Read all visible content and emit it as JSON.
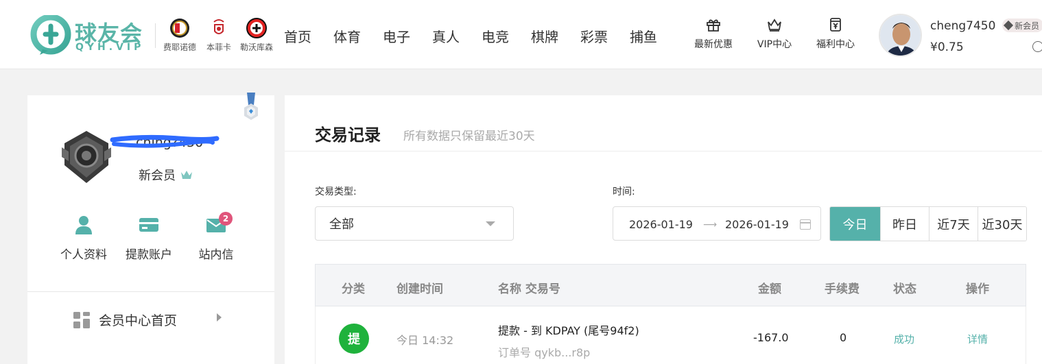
{
  "brand": {
    "name": "球友会",
    "sub": "QYH.VIP"
  },
  "clubs": [
    {
      "label": "费耶诺德",
      "icon": "feyenoord-badge-icon"
    },
    {
      "label": "本菲卡",
      "icon": "benfica-badge-icon"
    },
    {
      "label": "勒沃库森",
      "icon": "leverkusen-badge-icon"
    }
  ],
  "nav": [
    "首页",
    "体育",
    "电子",
    "真人",
    "电竞",
    "棋牌",
    "彩票",
    "捕鱼"
  ],
  "quick_links": [
    {
      "label": "最新优惠",
      "icon": "gift-icon"
    },
    {
      "label": "VIP中心",
      "icon": "crown-icon"
    },
    {
      "label": "福利中心",
      "icon": "welfare-card-icon"
    }
  ],
  "user": {
    "username": "cheng7450",
    "balance": "¥0.75",
    "vip_chip": "新会员"
  },
  "profile": {
    "name_visible": "ching?450",
    "level": "新会员",
    "shortcuts": [
      {
        "label": "个人资料",
        "icon": "user-icon"
      },
      {
        "label": "提款账户",
        "icon": "card-icon"
      },
      {
        "label": "站内信",
        "icon": "mail-icon",
        "badge": "2"
      }
    ],
    "menu_home": "会员中心首页"
  },
  "page": {
    "title": "交易记录",
    "subtitle": "所有数据只保留最近30天"
  },
  "filters": {
    "type_label": "交易类型:",
    "type_value": "全部",
    "time_label": "时间:",
    "date_from": "2026-01-19",
    "date_to": "2026-01-19",
    "range_buttons": [
      "今日",
      "昨日",
      "近7天",
      "近30天"
    ],
    "active_range": "今日"
  },
  "table": {
    "headers": [
      "分类",
      "创建时间",
      "名称 交易号",
      "金额",
      "手续费",
      "状态",
      "操作"
    ],
    "rows": [
      {
        "type": "提",
        "created": "今日 14:32",
        "name": "提款 - 到 KDPAY (尾号94f2)",
        "order": "订单号 qykb...r8p",
        "amount": "-167.0",
        "fee": "0",
        "status": "成功",
        "action": "详情"
      }
    ]
  },
  "colors": {
    "accent": "#55b1aa",
    "type_withdraw": "#1fb23c",
    "badge": "#e0557b",
    "logo": "#5ab5a8"
  }
}
